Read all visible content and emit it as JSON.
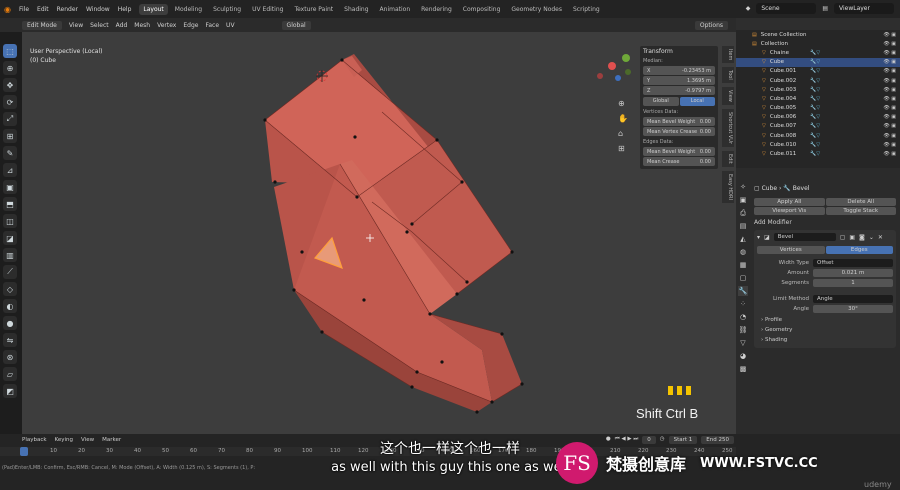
{
  "menu": [
    "File",
    "Edit",
    "Render",
    "Window",
    "Help"
  ],
  "workspaces": [
    {
      "label": "Layout",
      "active": true
    },
    {
      "label": "Modeling"
    },
    {
      "label": "Sculpting"
    },
    {
      "label": "UV Editing"
    },
    {
      "label": "Texture Paint"
    },
    {
      "label": "Shading"
    },
    {
      "label": "Animation"
    },
    {
      "label": "Rendering"
    },
    {
      "label": "Compositing"
    },
    {
      "label": "Geometry Nodes"
    },
    {
      "label": "Scripting"
    }
  ],
  "scene_field": "Scene",
  "viewlayer_field": "ViewLayer",
  "viewport_header": {
    "mode": "Edit Mode",
    "menus": [
      "View",
      "Select",
      "Add",
      "Mesh",
      "Vertex",
      "Edge",
      "Face",
      "UV"
    ],
    "orientation": "Global",
    "options": "Options"
  },
  "viewport": {
    "info_line1": "User Perspective (Local)",
    "info_line2": "(0) Cube"
  },
  "npanel": {
    "title": "Transform",
    "median_label": "Median:",
    "x_label": "X",
    "x": "-0.23453 m",
    "y_label": "Y",
    "y": "1.3695 m",
    "z_label": "Z",
    "z": "-0.9797 m",
    "global": "Global",
    "local": "Local",
    "vertices_data": "Vertices Data:",
    "mean_bevel_weight_label": "Mean Bevel Weight",
    "mean_bevel_weight": "0.00",
    "mean_vertex_crease_label": "Mean Vertex Crease",
    "mean_vertex_crease": "0.00",
    "edges_data": "Edges Data:",
    "edge_mean_bevel_weight_label": "Mean Bevel Weight",
    "edge_mean_bevel_weight": "0.00",
    "mean_crease_label": "Mean Crease",
    "mean_crease": "0.00",
    "tabs": [
      "Item",
      "Tool",
      "View",
      "Shortcut VUr",
      "Edit",
      "Easy HDRI"
    ]
  },
  "keycast": "Shift Ctrl B",
  "outliner": {
    "rows": [
      {
        "label": "Scene Collection",
        "indent": 0
      },
      {
        "label": "Collection",
        "indent": 0
      },
      {
        "label": "Chaine",
        "indent": 1
      },
      {
        "label": "Cube",
        "indent": 1,
        "selected": true
      },
      {
        "label": "Cube.001",
        "indent": 1
      },
      {
        "label": "Cube.002",
        "indent": 1
      },
      {
        "label": "Cube.003",
        "indent": 1
      },
      {
        "label": "Cube.004",
        "indent": 1
      },
      {
        "label": "Cube.005",
        "indent": 1
      },
      {
        "label": "Cube.006",
        "indent": 1
      },
      {
        "label": "Cube.007",
        "indent": 1
      },
      {
        "label": "Cube.008",
        "indent": 1
      },
      {
        "label": "Cube.010",
        "indent": 1
      },
      {
        "label": "Cube.011",
        "indent": 1
      }
    ]
  },
  "properties": {
    "crumb_object": "Cube",
    "crumb_modifier": "Bevel",
    "apply_all": "Apply All",
    "delete_all": "Delete All",
    "viewport_vis": "Viewport Vis",
    "toggle_stack": "Toggle Stack",
    "add_modifier": "Add Modifier",
    "modifier_name": "Bevel",
    "vertices": "Vertices",
    "edges": "Edges",
    "width_type_label": "Width Type",
    "width_type": "Offset",
    "amount_label": "Amount",
    "amount": "0.021 m",
    "segments_label": "Segments",
    "segments": "1",
    "limit_method_label": "Limit Method",
    "limit_method": "Angle",
    "angle_label": "Angle",
    "angle": "30°",
    "profile": "Profile",
    "geometry": "Geometry",
    "shading": "Shading"
  },
  "timeline": {
    "menus": [
      "Playback",
      "Keying",
      "View",
      "Marker"
    ],
    "current_frame": "0",
    "start_label": "Start",
    "start": "1",
    "end_label": "End",
    "end": "250",
    "ticks": [
      "0",
      "10",
      "20",
      "30",
      "40",
      "50",
      "60",
      "70",
      "80",
      "90",
      "100",
      "110",
      "120",
      "130",
      "140",
      "150",
      "160",
      "170",
      "180",
      "190",
      "200",
      "210",
      "220",
      "230",
      "240",
      "250"
    ],
    "status": "(Pad)Enter/LMB: Confirm, Esc/RMB: Cancel, M: Mode (Offset), A: Width (0.125 m), S: Segments (1), P:"
  },
  "subtitles": {
    "cn": "这个也一样这个也一样",
    "en": "as well with this guy this one as well"
  },
  "watermark": {
    "logo": "FS",
    "cn": "梵摄创意库",
    "url": "WWW.FSTVC.CC"
  },
  "udemy": "udemy",
  "colors": {
    "mesh": "#c25a4f",
    "accent": "#4772b3",
    "selected_row": "#334d80",
    "keycast_logo": "#f5c400"
  }
}
